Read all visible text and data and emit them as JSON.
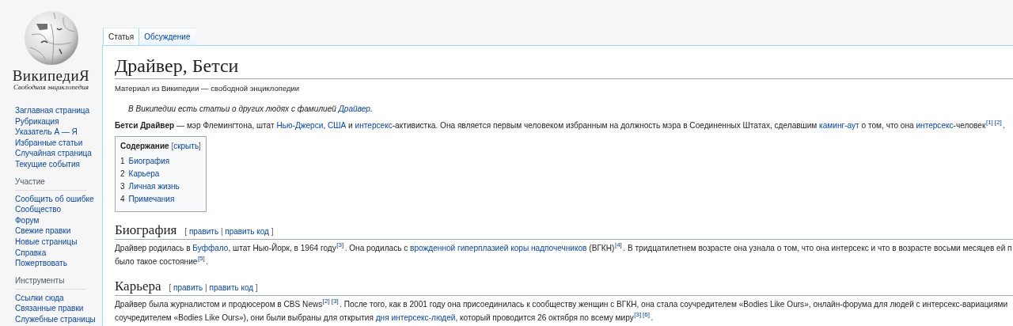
{
  "site": {
    "wordmark": "ВикипедиЯ",
    "tagline": "Свободная энциклопедия"
  },
  "sidebar": {
    "main": [
      "Заглавная страница",
      "Рубрикация",
      "Указатель А — Я",
      "Избранные статьи",
      "Случайная страница",
      "Текущие события"
    ],
    "sections": [
      {
        "heading": "Участие",
        "items": [
          "Сообщить об ошибке",
          "Сообщество",
          "Форум",
          "Свежие правки",
          "Новые страницы",
          "Справка",
          "Пожертвовать"
        ]
      },
      {
        "heading": "Инструменты",
        "items": [
          "Ссылки сюда",
          "Связанные правки",
          "Служебные страницы"
        ]
      }
    ]
  },
  "tabs": [
    {
      "label": "Статья",
      "selected": true
    },
    {
      "label": "Обсуждение",
      "selected": false
    }
  ],
  "article": {
    "title": "Драйвер, Бетси",
    "subtitle": "Материал из Википедии — свободной энциклопедии",
    "hatnote": [
      {
        "kind": "text",
        "text": "В Википедии есть статьи о других людях с фамилией "
      },
      {
        "kind": "link",
        "text": "Драйвер"
      },
      {
        "kind": "text",
        "text": "."
      }
    ],
    "lead": [
      [
        {
          "kind": "bold",
          "text": "Бетси Драйвер"
        },
        {
          "kind": "text",
          "text": " — мэр Флемингтона, штат "
        },
        {
          "kind": "link",
          "text": "Нью-Джерси"
        },
        {
          "kind": "text",
          "text": ", "
        },
        {
          "kind": "link",
          "text": "США"
        },
        {
          "kind": "text",
          "text": " и "
        },
        {
          "kind": "link",
          "text": "интерсекс"
        },
        {
          "kind": "text",
          "text": "-активистка. Она является первым человеком избранным на должность мэра в Соединенных Штатах, сделавшим "
        },
        {
          "kind": "link",
          "text": "каминг-аут"
        },
        {
          "kind": "text",
          "text": " о том, что она "
        },
        {
          "kind": "link",
          "text": "интерсекс"
        },
        {
          "kind": "text",
          "text": "-человек"
        },
        {
          "kind": "ref",
          "text": "[1]"
        },
        {
          "kind": "ref",
          "text": "[2]"
        },
        {
          "kind": "text",
          "text": "."
        }
      ]
    ],
    "toc": {
      "title": "Содержание",
      "toggle": [
        {
          "kind": "text",
          "text": "["
        },
        {
          "kind": "link",
          "text": "скрыть"
        },
        {
          "kind": "text",
          "text": "]"
        }
      ],
      "items": [
        {
          "number": "1",
          "label": "Биография"
        },
        {
          "number": "2",
          "label": "Карьера"
        },
        {
          "number": "3",
          "label": "Личная жизнь"
        },
        {
          "number": "4",
          "label": "Примечания"
        }
      ]
    },
    "sections": [
      {
        "heading": "Биография",
        "edit": [
          {
            "kind": "text",
            "text": "[ "
          },
          {
            "kind": "link",
            "text": "править"
          },
          {
            "kind": "text",
            "text": " | "
          },
          {
            "kind": "link",
            "text": "править код"
          },
          {
            "kind": "text",
            "text": " ]"
          }
        ],
        "paragraph": [
          [
            {
              "kind": "text",
              "text": "Драйвер родилась в "
            },
            {
              "kind": "link",
              "text": "Буффало"
            },
            {
              "kind": "text",
              "text": ", штат Нью-Йорк, в 1964 году"
            },
            {
              "kind": "ref",
              "text": "[3]"
            },
            {
              "kind": "text",
              "text": ". Она родилась с "
            },
            {
              "kind": "link",
              "text": "врожденной гиперплазией коры надпочечников"
            },
            {
              "kind": "text",
              "text": " (ВГКН)"
            },
            {
              "kind": "ref",
              "text": "[4]"
            },
            {
              "kind": "text",
              "text": ". В тридцатилетнем возрасте она узнала о том, что она интерсекс и что в возрасте восьми месяцев ей п"
            }
          ],
          [
            {
              "kind": "text",
              "text": "было такое состояние"
            },
            {
              "kind": "ref",
              "text": "[5]"
            },
            {
              "kind": "text",
              "text": "."
            }
          ]
        ]
      },
      {
        "heading": "Карьера",
        "edit": [
          {
            "kind": "text",
            "text": "[ "
          },
          {
            "kind": "link",
            "text": "править"
          },
          {
            "kind": "text",
            "text": " | "
          },
          {
            "kind": "link",
            "text": "править код"
          },
          {
            "kind": "text",
            "text": " ]"
          }
        ],
        "paragraph": [
          [
            {
              "kind": "text",
              "text": "Драйвер была журналистом и продюсером в CBS News"
            },
            {
              "kind": "ref",
              "text": "[2]"
            },
            {
              "kind": "ref",
              "text": "[3]"
            },
            {
              "kind": "text",
              "text": ". После того, как в 2001 году она присоединилась к сообществу женщин с ВГКН, она стала соучредителем «Bodies Like Ours», онлайн-форума для людей с интерсекс-вариациями"
            }
          ],
          [
            {
              "kind": "text",
              "text": "соучредителем «Bodies Like Ours»), они были выбраны для открытия "
            },
            {
              "kind": "link",
              "text": "дня интерсекс-людей"
            },
            {
              "kind": "text",
              "text": ", который проводится 26 октября по всему миру"
            },
            {
              "kind": "ref",
              "text": "[3]"
            },
            {
              "kind": "ref",
              "text": "[6]"
            },
            {
              "kind": "text",
              "text": "."
            }
          ]
        ]
      }
    ]
  }
}
